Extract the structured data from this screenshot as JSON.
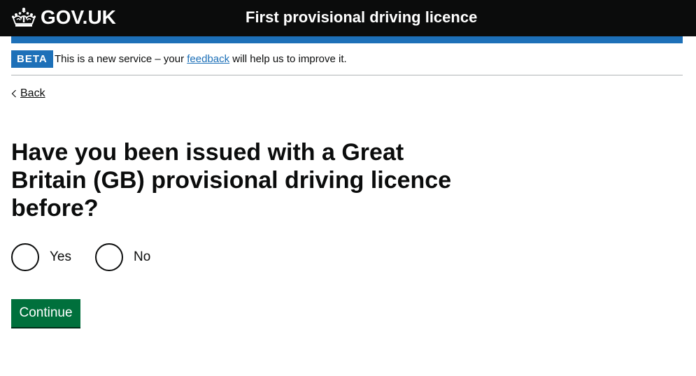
{
  "header": {
    "logo_text": "GOV.UK",
    "service_name": "First provisional driving licence"
  },
  "phase_banner": {
    "tag": "BETA",
    "text_before": "This is a new service – your ",
    "feedback_link": "feedback",
    "text_after": " will help us to improve it."
  },
  "back_link": "Back",
  "question": "Have you been issued with a Great Britain (GB) provisional driving licence before?",
  "radios": [
    {
      "label": "Yes",
      "checked": false
    },
    {
      "label": "No",
      "checked": false
    }
  ],
  "continue_label": "Continue",
  "colors": {
    "header_bg": "#0b0c0c",
    "brand_blue": "#1d70b8",
    "button_green": "#00703c",
    "text": "#0b0c0c"
  },
  "icons": [
    "crown-icon",
    "chevron-left-icon"
  ]
}
